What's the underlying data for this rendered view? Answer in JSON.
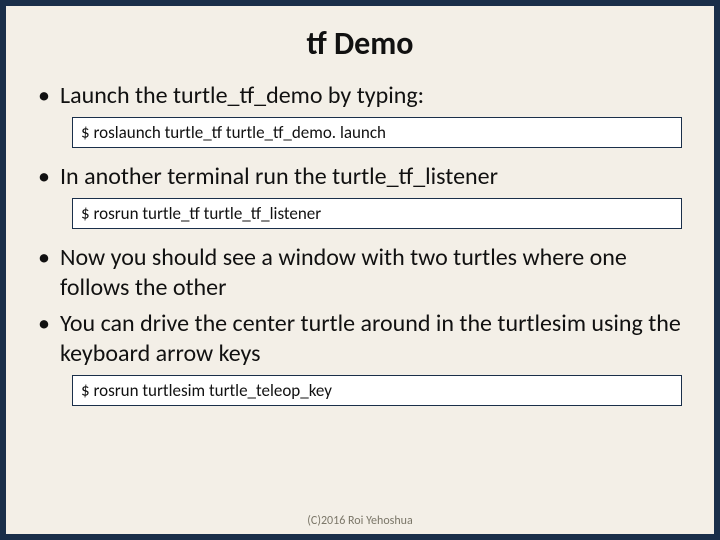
{
  "title": "tf Demo",
  "bullets": {
    "b1": "Launch the turtle_tf_demo by typing:",
    "b2": "In another terminal run the turtle_tf_listener",
    "b3": "Now you should see a window with two turtles where one follows the other",
    "b4": "You can drive the center turtle around in the turtlesim using the keyboard arrow keys"
  },
  "commands": {
    "c1": "$ roslaunch turtle_tf turtle_tf_demo. launch",
    "c2": "$ rosrun turtle_tf turtle_tf_listener",
    "c3": "$ rosrun turtlesim turtle_teleop_key"
  },
  "footer": "(C)2016 Roi Yehoshua"
}
